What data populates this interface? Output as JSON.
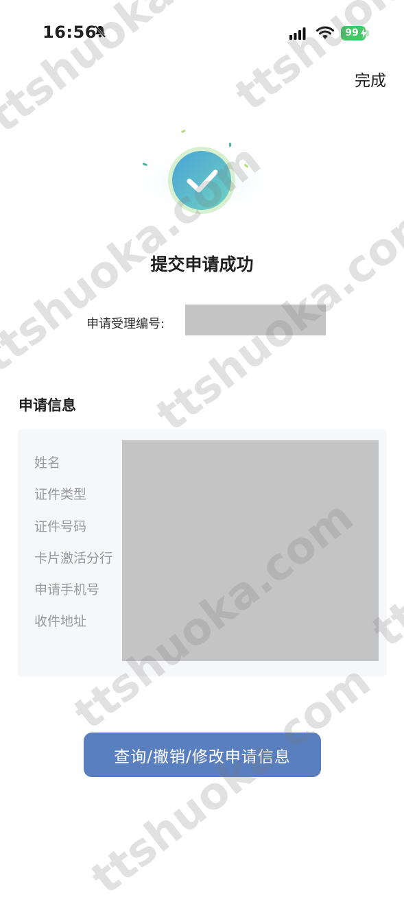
{
  "status_bar": {
    "time": "16:56",
    "battery_level": "99"
  },
  "header": {
    "done_label": "完成"
  },
  "result": {
    "title": "提交申请成功",
    "reference_label": "申请受理编号:"
  },
  "application_info": {
    "section_title": "申请信息",
    "fields": [
      {
        "label": "姓名"
      },
      {
        "label": "证件类型"
      },
      {
        "label": "证件号码"
      },
      {
        "label": "卡片激活分行"
      },
      {
        "label": "申请手机号"
      },
      {
        "label": "收件地址"
      }
    ]
  },
  "actions": {
    "manage_label": "查询/撤销/修改申请信息"
  },
  "watermark": {
    "text_a": "ttshuoka.com",
    "text_b": "ttshuoka.com",
    "text_c": "ttshuoka.com",
    "text_d": "ttshuoka.com",
    "text_e": "ttshuoka.com",
    "text_f": "ttshuoka.com",
    "text_g": "ttshuoka.com"
  },
  "colors": {
    "primary_button": "#5a7fbf",
    "battery": "#44c767",
    "success_gradient_start": "#4aa3d6",
    "success_gradient_end": "#6fd2c1",
    "redaction": "#c4c4c4"
  }
}
